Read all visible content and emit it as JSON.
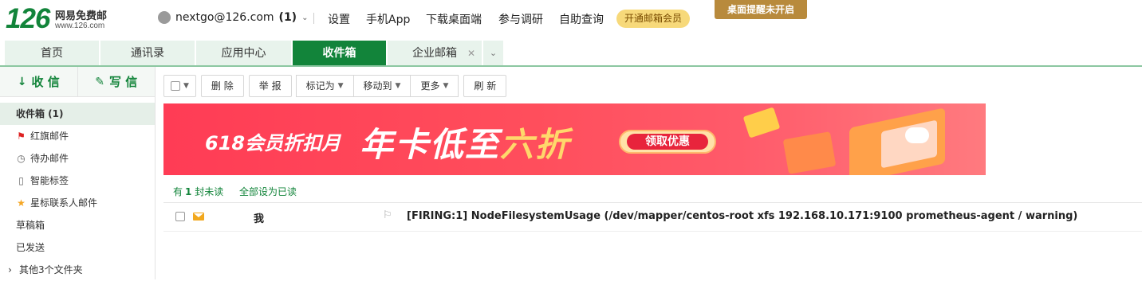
{
  "brand": {
    "logo_number": "126",
    "name": "网易免费邮",
    "url": "www.126.com",
    "color": "#12843a"
  },
  "account": {
    "email": "nextgo@126.com",
    "unread": "(1)"
  },
  "topnav": [
    "设置",
    "手机App",
    "下载桌面端",
    "参与调研",
    "自助查询"
  ],
  "vip_button": "开通邮箱会员",
  "remind_button": "桌面提醒未开启",
  "tabs": [
    {
      "label": "首页"
    },
    {
      "label": "通讯录"
    },
    {
      "label": "应用中心"
    },
    {
      "label": "收件箱",
      "active": true
    },
    {
      "label": "企业邮箱"
    }
  ],
  "sidebar": {
    "receive": "收 信",
    "compose": "写 信",
    "folders": [
      {
        "label": "收件箱 (1)",
        "icon": "",
        "active": true
      },
      {
        "label": "红旗邮件",
        "icon": "flag-icon"
      },
      {
        "label": "待办邮件",
        "icon": "clock-icon"
      },
      {
        "label": "智能标签",
        "icon": "tag-icon"
      },
      {
        "label": "星标联系人邮件",
        "icon": "star-icon"
      },
      {
        "label": "草稿箱",
        "icon": ""
      },
      {
        "label": "已发送",
        "icon": ""
      },
      {
        "label": "其他3个文件夹",
        "icon": "chevron-right-icon"
      }
    ]
  },
  "toolbar": {
    "delete": "删 除",
    "report": "举 报",
    "mark_as": "标记为",
    "move_to": "移动到",
    "more": "更多",
    "refresh": "刷 新"
  },
  "banner": {
    "promo": "618会员折扣月",
    "headline_a": "年卡低至",
    "headline_b": "六折",
    "cta": "领取优惠"
  },
  "list": {
    "unread_prefix": "有",
    "unread_count": "1",
    "unread_suffix": "封未读",
    "mark_all_read": "全部设为已读",
    "messages": [
      {
        "from": "我",
        "subject": "[FIRING:1] NodeFilesystemUsage (/dev/mapper/centos-root xfs 192.168.10.171:9100 prometheus-agent / warning)"
      }
    ]
  }
}
